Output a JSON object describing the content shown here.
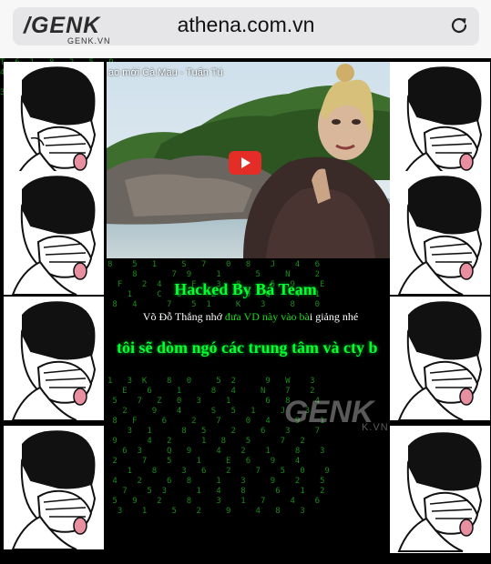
{
  "browser": {
    "logo_text": "/GENK",
    "logo_sub": "GENK.VN",
    "url": "athena.com.vn"
  },
  "video": {
    "title": "ao mới Cà Mau - Tuấn Tú"
  },
  "message": {
    "heading": "Hacked By Bá Team",
    "line2_a": "Võ Đỗ Thắng nhớ ",
    "line2_b": "đưa VD này vào bà",
    "line2_c": "i giảng nhé",
    "line3": "tôi sẽ dòm ngó các trung tâm và cty b"
  },
  "watermark": {
    "text": "GENK",
    "sub": "K.VN"
  },
  "colors": {
    "matrix_green": "#00ff33",
    "youtube_red": "#e52d27"
  },
  "icons": [
    "reload-icon",
    "play-icon",
    "meme-image"
  ]
}
